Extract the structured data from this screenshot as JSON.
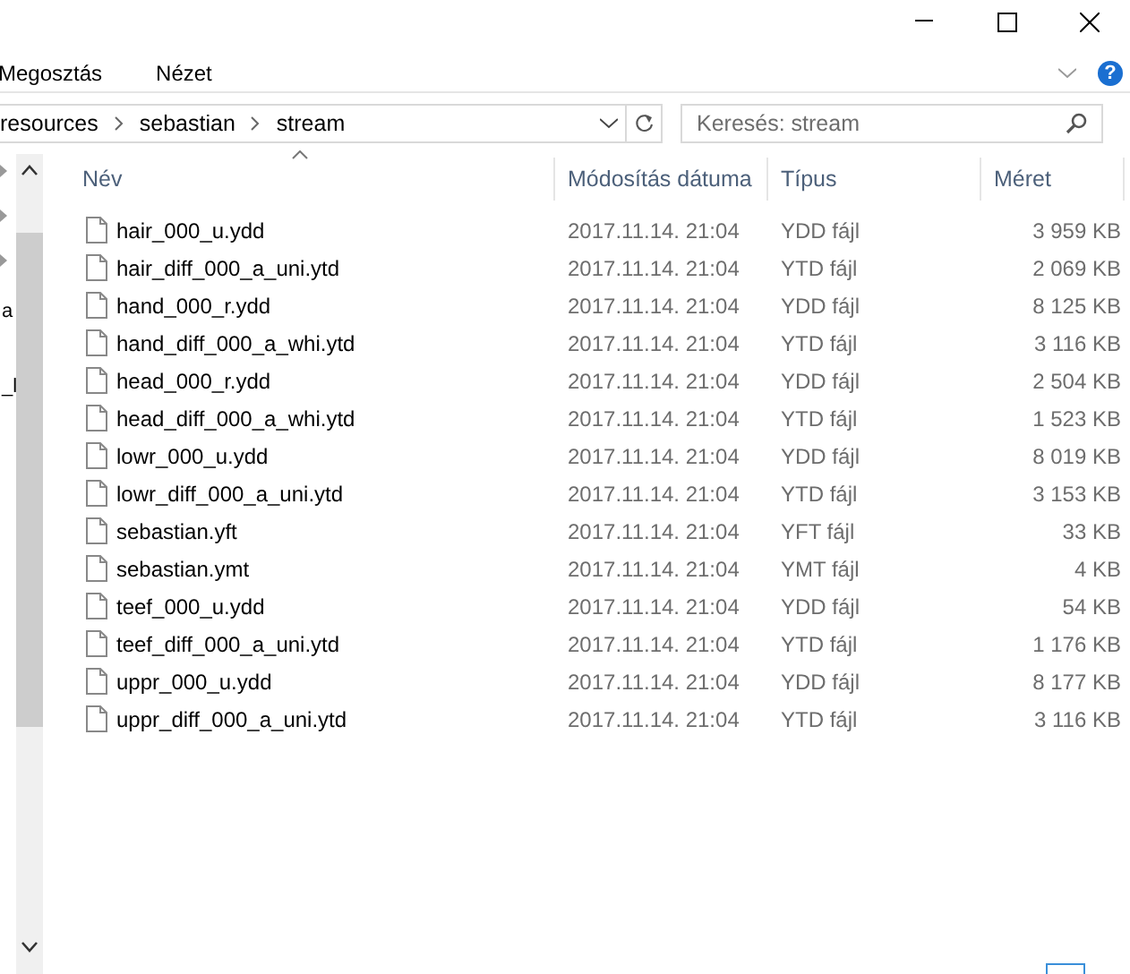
{
  "ribbon": {
    "tabs": [
      {
        "label": "Megosztás"
      },
      {
        "label": "Nézet"
      }
    ]
  },
  "address": {
    "crumbs": [
      "resources",
      "sebastian",
      "stream"
    ]
  },
  "search": {
    "placeholder": "Keresés: stream"
  },
  "help": "?",
  "nav": {
    "items": [
      "a",
      "_l"
    ]
  },
  "table": {
    "columns": [
      "Név",
      "Módosítás dátuma",
      "Típus",
      "Méret"
    ],
    "rows": [
      {
        "name": "hair_000_u.ydd",
        "date": "2017.11.14. 21:04",
        "type": "YDD fájl",
        "size": "3 959 KB"
      },
      {
        "name": "hair_diff_000_a_uni.ytd",
        "date": "2017.11.14. 21:04",
        "type": "YTD fájl",
        "size": "2 069 KB"
      },
      {
        "name": "hand_000_r.ydd",
        "date": "2017.11.14. 21:04",
        "type": "YDD fájl",
        "size": "8 125 KB"
      },
      {
        "name": "hand_diff_000_a_whi.ytd",
        "date": "2017.11.14. 21:04",
        "type": "YTD fájl",
        "size": "3 116 KB"
      },
      {
        "name": "head_000_r.ydd",
        "date": "2017.11.14. 21:04",
        "type": "YDD fájl",
        "size": "2 504 KB"
      },
      {
        "name": "head_diff_000_a_whi.ytd",
        "date": "2017.11.14. 21:04",
        "type": "YTD fájl",
        "size": "1 523 KB"
      },
      {
        "name": "lowr_000_u.ydd",
        "date": "2017.11.14. 21:04",
        "type": "YDD fájl",
        "size": "8 019 KB"
      },
      {
        "name": "lowr_diff_000_a_uni.ytd",
        "date": "2017.11.14. 21:04",
        "type": "YTD fájl",
        "size": "3 153 KB"
      },
      {
        "name": "sebastian.yft",
        "date": "2017.11.14. 21:04",
        "type": "YFT fájl",
        "size": "33 KB"
      },
      {
        "name": "sebastian.ymt",
        "date": "2017.11.14. 21:04",
        "type": "YMT fájl",
        "size": "4 KB"
      },
      {
        "name": "teef_000_u.ydd",
        "date": "2017.11.14. 21:04",
        "type": "YDD fájl",
        "size": "54 KB"
      },
      {
        "name": "teef_diff_000_a_uni.ytd",
        "date": "2017.11.14. 21:04",
        "type": "YTD fájl",
        "size": "1 176 KB"
      },
      {
        "name": "uppr_000_u.ydd",
        "date": "2017.11.14. 21:04",
        "type": "YDD fájl",
        "size": "8 177 KB"
      },
      {
        "name": "uppr_diff_000_a_uni.ytd",
        "date": "2017.11.14. 21:04",
        "type": "YTD fájl",
        "size": "3 116 KB"
      }
    ]
  }
}
